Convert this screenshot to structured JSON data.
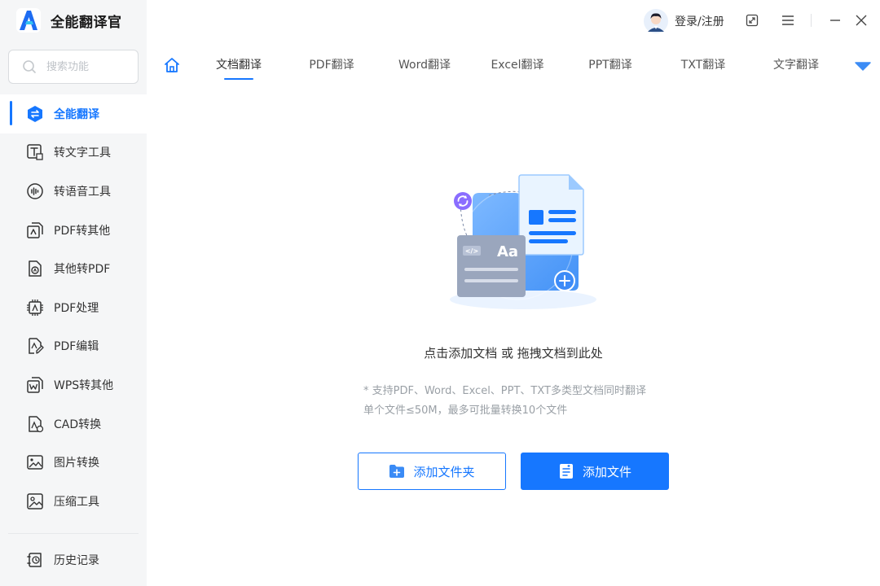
{
  "app": {
    "name": "全能翻译官",
    "accent": "#1677ff"
  },
  "search": {
    "placeholder": "搜索功能"
  },
  "sidebar": {
    "items": [
      {
        "label": "全能翻译",
        "icon": "swap-icon",
        "active": true
      },
      {
        "label": "转文字工具",
        "icon": "text-convert-icon"
      },
      {
        "label": "转语音工具",
        "icon": "voice-wave-icon"
      },
      {
        "label": "PDF转其他",
        "icon": "pdf-export-icon"
      },
      {
        "label": "其他转PDF",
        "icon": "pdf-import-icon"
      },
      {
        "label": "PDF处理",
        "icon": "pdf-process-icon"
      },
      {
        "label": "PDF编辑",
        "icon": "pdf-edit-icon"
      },
      {
        "label": "WPS转其他",
        "icon": "wps-icon"
      },
      {
        "label": "CAD转换",
        "icon": "cad-icon"
      },
      {
        "label": "图片转换",
        "icon": "image-icon"
      },
      {
        "label": "压缩工具",
        "icon": "compress-icon"
      }
    ],
    "history": {
      "label": "历史记录",
      "icon": "history-icon"
    }
  },
  "header": {
    "login_label": "登录/注册",
    "icons": [
      "avatar-icon",
      "restore-icon",
      "menu-icon",
      "minimize-icon",
      "close-icon"
    ]
  },
  "tabs": {
    "home_icon": "home-icon",
    "items": [
      {
        "label": "文档翻译",
        "active": true
      },
      {
        "label": "PDF翻译"
      },
      {
        "label": "Word翻译"
      },
      {
        "label": "Excel翻译"
      },
      {
        "label": "PPT翻译"
      },
      {
        "label": "TXT翻译"
      },
      {
        "label": "文字翻译"
      }
    ],
    "more_icon": "triangle-down-icon"
  },
  "main": {
    "drop_title": "点击添加文档 或 拖拽文档到此处",
    "hint_line1": "* 支持PDF、Word、Excel、PPT、TXT多类型文档同时翻译",
    "hint_line2": "单个文件≤50M，最多可批量转换10个文件",
    "add_folder_label": "添加文件夹",
    "add_file_label": "添加文件",
    "illustration_text": "Aa"
  }
}
